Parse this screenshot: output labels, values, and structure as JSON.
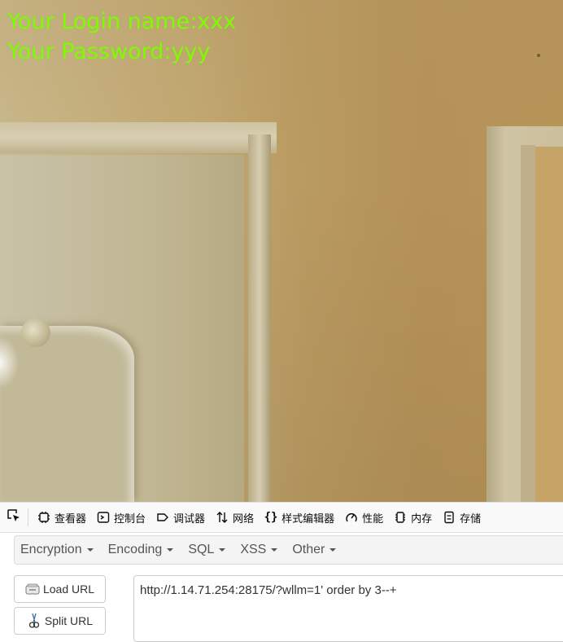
{
  "page": {
    "login_line": "Your Login name:xxx",
    "password_line": "Your Password:yyy"
  },
  "devtools": {
    "tabs": [
      {
        "label": "查看器",
        "icon": "inspector-icon"
      },
      {
        "label": "控制台",
        "icon": "console-icon"
      },
      {
        "label": "调试器",
        "icon": "debugger-icon"
      },
      {
        "label": "网络",
        "icon": "network-icon"
      },
      {
        "label": "样式编辑器",
        "icon": "style-editor-icon"
      },
      {
        "label": "性能",
        "icon": "performance-icon"
      },
      {
        "label": "内存",
        "icon": "memory-icon"
      },
      {
        "label": "存储",
        "icon": "storage-icon"
      }
    ]
  },
  "hackbar": {
    "menu": [
      "Encryption",
      "Encoding",
      "SQL",
      "XSS",
      "Other"
    ],
    "load_url_label": "Load URL",
    "split_url_label": "Split URL",
    "url_value": "http://1.14.71.254:28175/?wllm=1' order by 3--+"
  },
  "colors": {
    "overlay_text": "#7cfc00"
  }
}
